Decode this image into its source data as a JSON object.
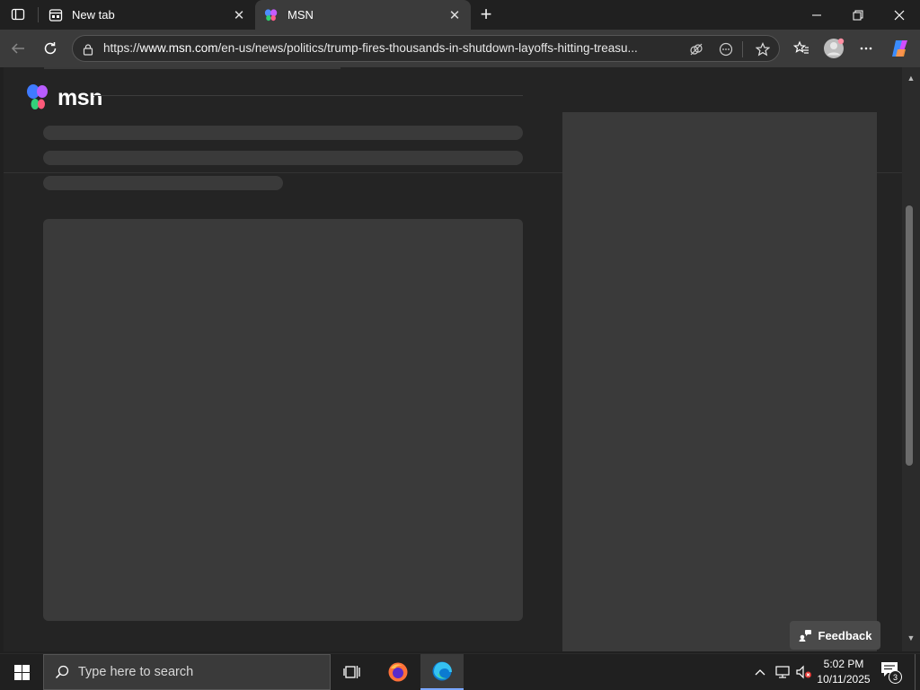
{
  "browser": {
    "tabs": [
      {
        "title": "New tab",
        "active": false,
        "icon": "new-tab-page-icon"
      },
      {
        "title": "MSN",
        "active": true,
        "icon": "msn-butterfly-icon"
      }
    ],
    "address": {
      "url_prefix": "https://",
      "url_host": "www.msn.com",
      "url_path": "/en-us/news/politics/trump-fires-thousands-in-shutdown-layoffs-hitting-treasu..."
    }
  },
  "page": {
    "logo_text": "msn",
    "feedback_label": "Feedback"
  },
  "taskbar": {
    "search_placeholder": "Type here to search",
    "time": "5:02 PM",
    "date": "10/11/2025",
    "notification_count": "3"
  },
  "colors": {
    "background": "#202020",
    "toolbar": "#3b3b3b",
    "skeleton": "#3a3a3a",
    "accent": "#7aa7ff"
  }
}
